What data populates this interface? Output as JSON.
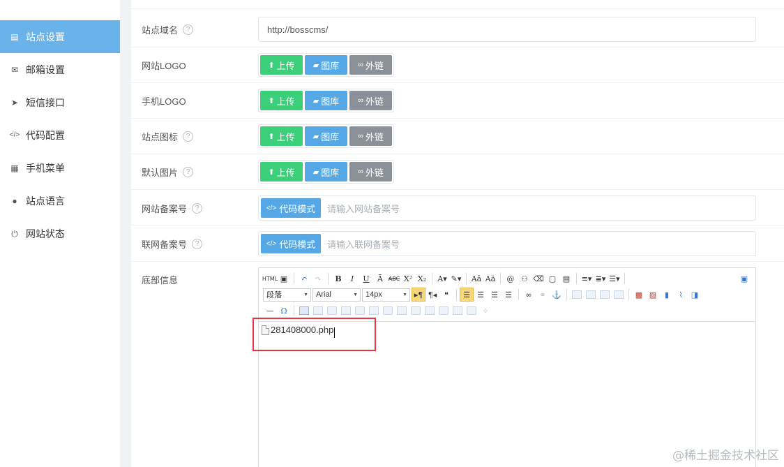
{
  "sidebar": {
    "items": [
      {
        "label": "站点设置",
        "icon": "list-icon"
      },
      {
        "label": "邮箱设置",
        "icon": "envelope-icon"
      },
      {
        "label": "短信接口",
        "icon": "send-icon"
      },
      {
        "label": "代码配置",
        "icon": "code-icon"
      },
      {
        "label": "手机菜单",
        "icon": "calendar-icon"
      },
      {
        "label": "站点语言",
        "icon": "globe-icon"
      },
      {
        "label": "网站状态",
        "icon": "power-icon"
      }
    ]
  },
  "form": {
    "domain_label": "站点域名",
    "domain_value": "http://bosscms/",
    "logo_label": "网站LOGO",
    "mobile_logo_label": "手机LOGO",
    "favicon_label": "站点图标",
    "default_image_label": "默认图片",
    "upload_label": "上传",
    "gallery_label": "图库",
    "external_label": "外链",
    "icp_label": "网站备案号",
    "icp_placeholder": "请输入网站备案号",
    "police_label": "联网备案号",
    "police_placeholder": "请输入联网备案号",
    "code_mode_label": "代码模式",
    "footer_label": "底部信息",
    "help": "?"
  },
  "editor": {
    "paragraph": "段落",
    "font": "Arial",
    "size": "14px",
    "content_file": "281408000.php"
  },
  "watermark": "@稀土掘金技术社区"
}
